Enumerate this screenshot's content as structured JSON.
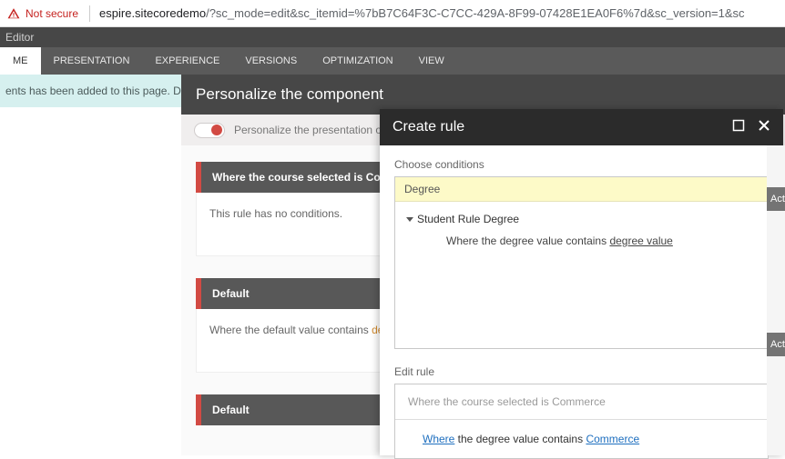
{
  "url_bar": {
    "not_secure": "Not secure",
    "host": "espire.sitecoredemo",
    "path": "/?sc_mode=edit&sc_itemid=%7bB7C64F3C-C7CC-429A-8F99-07428E1EA0F6%7d&sc_version=1&sc"
  },
  "editor_header": "Editor",
  "tabs": {
    "home": "ME",
    "presentation": "PRESENTATION",
    "experience": "EXPERIENCE",
    "versions": "VERSIONS",
    "optimization": "OPTIMIZATION",
    "view": "VIEW"
  },
  "banner": "ents has been added to this page. Do you wan",
  "personalize": {
    "title": "Personalize the component",
    "sub": "Personalize the presentation of the co",
    "rule1_header": "Where the course selected is Commerce",
    "rule1_body": "This rule has no conditions.",
    "rule2_header": "Default",
    "rule2_body_prefix": "Where the default value contains ",
    "rule2_body_link": "default valu",
    "rule3_header": "Default"
  },
  "create_rule": {
    "title": "Create rule",
    "choose_label": "Choose conditions",
    "search_value": "Degree",
    "tree_group": "Student Rule Degree",
    "tree_rule_prefix": "Where the degree value contains ",
    "tree_rule_link": "degree value",
    "edit_label": "Edit rule",
    "edit_top": "Where the course selected is Commerce",
    "edit_bottom_where": "Where",
    "edit_bottom_mid": " the degree value contains ",
    "edit_bottom_val": "Commerce"
  },
  "sliver": {
    "act": "Acti"
  }
}
